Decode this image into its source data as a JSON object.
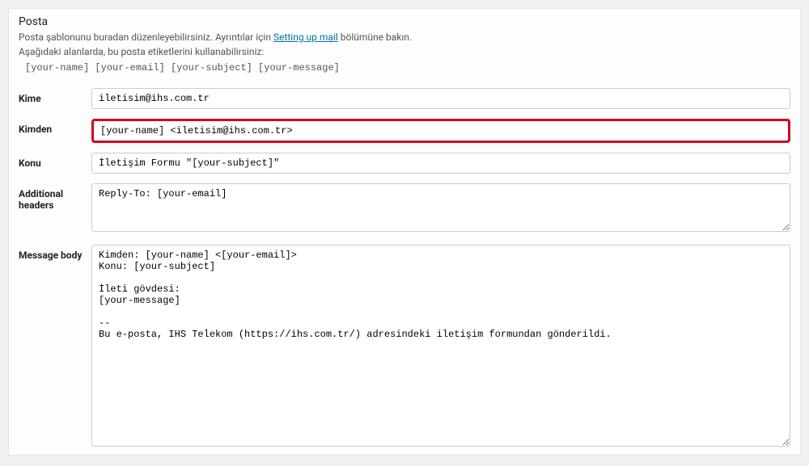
{
  "panel": {
    "title": "Posta",
    "desc_before": "Posta şablonunu buradan düzenleyebilirsiniz. Ayrıntılar için ",
    "desc_link": "Setting up mail",
    "desc_after": " bölümüne bakın.",
    "desc_line2": "Aşağıdaki alanlarda, bu posta etiketlerini kullanabilirsiniz:",
    "tags": "[your-name] [your-email] [your-subject] [your-message]"
  },
  "fields": {
    "to_label": "Kime",
    "to_value": "iletisim@ihs.com.tr",
    "from_label": "Kimden",
    "from_value": "[your-name] <iletisim@ihs.com.tr>",
    "subject_label": "Konu",
    "subject_value": "İletişim Formu \"[your-subject]\"",
    "headers_label": "Additional headers",
    "headers_value": "Reply-To: [your-email]",
    "body_label": "Message body",
    "body_value": "Kimden: [your-name] <[your-email]>\nKonu: [your-subject]\n\nİleti gövdesi:\n[your-message]\n\n--\nBu e-posta, IHS Telekom (https://ihs.com.tr/) adresindeki iletişim formundan gönderildi."
  }
}
